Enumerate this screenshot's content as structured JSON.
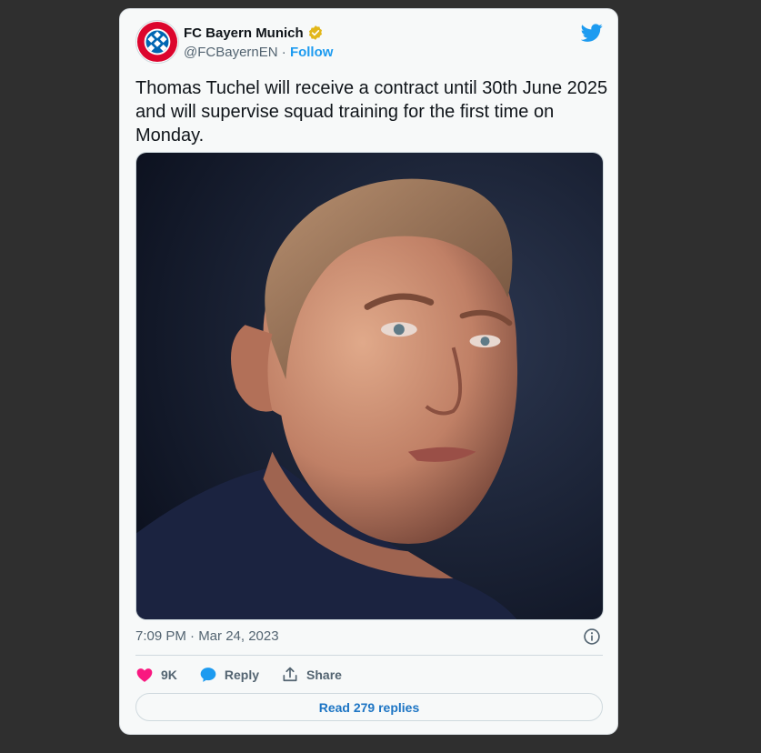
{
  "tweet": {
    "account_name": "FC Bayern Munich",
    "handle": "@FCBayernEN",
    "separator": " · ",
    "follow_label": "Follow",
    "text": "Thomas Tuchel will receive a contract until 30th June 2025 and will supervise squad training for the first time on Monday.",
    "timestamp": "7:09 PM · Mar 24, 2023",
    "likes_count": "9K",
    "reply_label": "Reply",
    "share_label": "Share",
    "read_replies_label": "Read 279 replies"
  },
  "icons": {
    "brand": "twitter-bird-icon",
    "verified": "verified-badge-icon",
    "info": "info-icon",
    "like": "heart-icon",
    "reply": "speech-bubble-icon",
    "share": "share-upload-icon"
  },
  "colors": {
    "accent": "#1d9bf0",
    "verified_gold": "#e2b719",
    "like_pink": "#f91880",
    "bayern_red": "#dc052d",
    "bayern_blue": "#0066b2"
  }
}
